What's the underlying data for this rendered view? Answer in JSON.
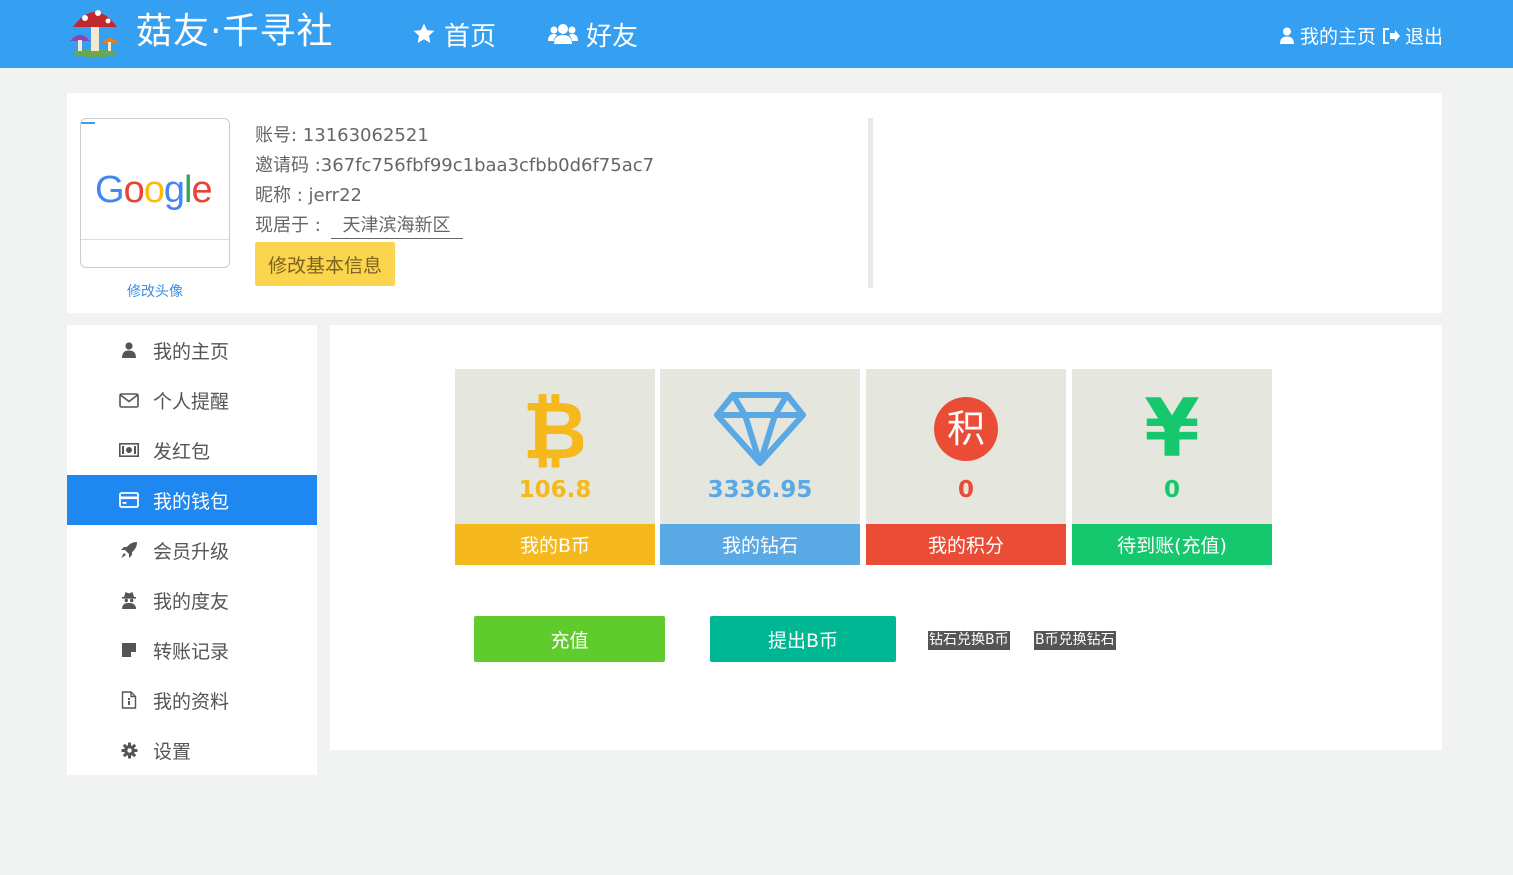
{
  "header": {
    "brand": "菇友·千寻社",
    "nav": [
      {
        "label": "首页",
        "icon": "star-icon"
      },
      {
        "label": "好友",
        "icon": "users-icon"
      }
    ],
    "my_home": "我的主页",
    "logout": "退出"
  },
  "profile": {
    "avatar_text": "Google",
    "change_avatar": "修改头像",
    "account_label": "账号: ",
    "account": "13163062521",
    "invite_label": "邀请码 :",
    "invite_code": "367fc756fbf99c1baa3cfbb0d6f75ac7",
    "nickname_label": "昵称 : ",
    "nickname": "jerr22",
    "location_label": "现居于 : ",
    "location": "天津滨海新区",
    "edit_button": "修改基本信息"
  },
  "sidebar": {
    "items": [
      {
        "label": "我的主页",
        "icon": "user-icon"
      },
      {
        "label": "个人提醒",
        "icon": "envelope-icon"
      },
      {
        "label": "发红包",
        "icon": "money-icon"
      },
      {
        "label": "我的钱包",
        "icon": "credit-card-icon",
        "active": true
      },
      {
        "label": "会员升级",
        "icon": "rocket-icon"
      },
      {
        "label": "我的度友",
        "icon": "user-secret-icon"
      },
      {
        "label": "转账记录",
        "icon": "sticky-note-icon"
      },
      {
        "label": "我的资料",
        "icon": "file-icon"
      },
      {
        "label": "设置",
        "icon": "gear-icon"
      }
    ]
  },
  "wallet": {
    "stats": [
      {
        "value": "106.8",
        "label": "我的B币",
        "icon": "bitcoin-icon",
        "color": "#f5b91e"
      },
      {
        "value": "3336.95",
        "label": "我的钻石",
        "icon": "diamond-icon",
        "color": "#5aa9e4"
      },
      {
        "value": "0",
        "label": "我的积分",
        "icon": "points-icon",
        "icon_text": "积",
        "color": "#ea4c36"
      },
      {
        "value": "0",
        "label": "待到账(充值)",
        "icon": "yen-icon",
        "icon_text": "¥",
        "color": "#16c86d"
      }
    ],
    "buttons": {
      "recharge": "充值",
      "withdraw": "提出B币",
      "diamond_to_b": "钻石兑换B币",
      "b_to_diamond": "B币兑换钻石"
    }
  }
}
